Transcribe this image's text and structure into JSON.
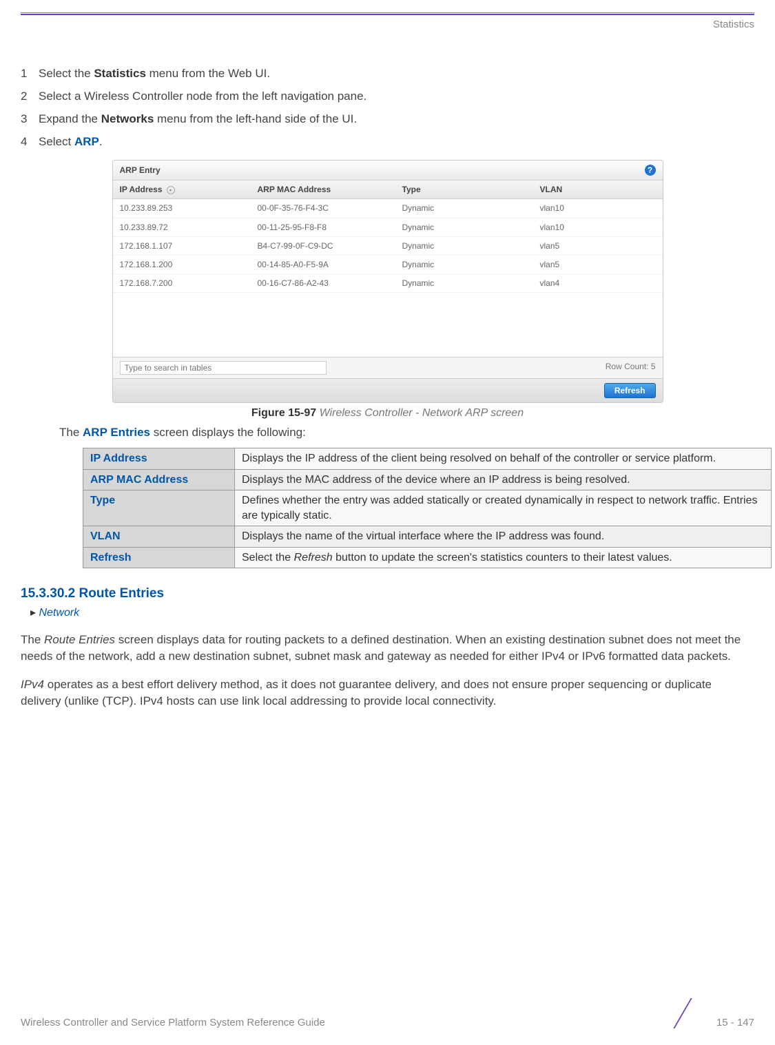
{
  "header": {
    "title": "Statistics"
  },
  "steps": [
    {
      "num": "1",
      "pre": "Select the ",
      "bold": "Statistics",
      "post": " menu from the Web UI."
    },
    {
      "num": "2",
      "pre": "Select a Wireless Controller node from the left navigation pane.",
      "bold": "",
      "post": ""
    },
    {
      "num": "3",
      "pre": "Expand the ",
      "bold": "Networks",
      "post": " menu from the left-hand side of the UI."
    },
    {
      "num": "4",
      "pre": "Select ",
      "bold": "ARP",
      "post": "."
    }
  ],
  "screenshot": {
    "panel_title": "ARP Entry",
    "help": "?",
    "columns": {
      "ip": "IP Address",
      "mac": "ARP MAC Address",
      "type": "Type",
      "vlan": "VLAN"
    },
    "rows": [
      {
        "ip": "10.233.89.253",
        "mac": "00-0F-35-76-F4-3C",
        "type": "Dynamic",
        "vlan": "vlan10"
      },
      {
        "ip": "10.233.89.72",
        "mac": "00-11-25-95-F8-F8",
        "type": "Dynamic",
        "vlan": "vlan10"
      },
      {
        "ip": "172.168.1.107",
        "mac": "B4-C7-99-0F-C9-DC",
        "type": "Dynamic",
        "vlan": "vlan5"
      },
      {
        "ip": "172.168.1.200",
        "mac": "00-14-85-A0-F5-9A",
        "type": "Dynamic",
        "vlan": "vlan5"
      },
      {
        "ip": "172.168.7.200",
        "mac": "00-16-C7-86-A2-43",
        "type": "Dynamic",
        "vlan": "vlan4"
      }
    ],
    "search_placeholder": "Type to search in tables",
    "row_count_label": "Row Count:",
    "row_count_value": "5",
    "refresh_label": "Refresh"
  },
  "figure": {
    "label": "Figure 15-97",
    "caption": "Wireless Controller - Network ARP screen"
  },
  "intro": {
    "pre": "The ",
    "bold": "ARP Entries",
    "post": " screen displays the following:"
  },
  "desc_table": [
    {
      "term": "IP Address",
      "def": "Displays the IP address of the client being resolved on behalf of the controller or service platform."
    },
    {
      "term": "ARP MAC Address",
      "def": "Displays the MAC address of the device where an IP address is being resolved."
    },
    {
      "term": "Type",
      "def": "Defines whether the entry was added statically or created dynamically in respect to network traffic. Entries are typically static."
    },
    {
      "term": "VLAN",
      "def": "Displays the name of the virtual interface where the IP address was found."
    },
    {
      "term": "Refresh",
      "def_pre": "Select the ",
      "def_em": "Refresh",
      "def_post": " button to update the screen's statistics counters to their latest values."
    }
  ],
  "section": {
    "number": "15.3.30.2",
    "title": "Route Entries"
  },
  "breadcrumb": "Network",
  "para1": {
    "em": "Route Entries",
    "pre": "The ",
    "post": " screen displays data for routing packets to a defined destination. When an existing destination subnet does not meet the needs of the network, add a new destination subnet, subnet mask and gateway as needed for either IPv4 or IPv6 formatted data packets."
  },
  "para2": {
    "em": "IPv4",
    "post": " operates as a best effort delivery method, as it does not guarantee delivery, and does not ensure proper sequencing or duplicate delivery (unlike (TCP). IPv4 hosts can use link local addressing to provide local connectivity."
  },
  "footer": {
    "guide": "Wireless Controller and Service Platform System Reference Guide",
    "page": "15 - 147"
  }
}
